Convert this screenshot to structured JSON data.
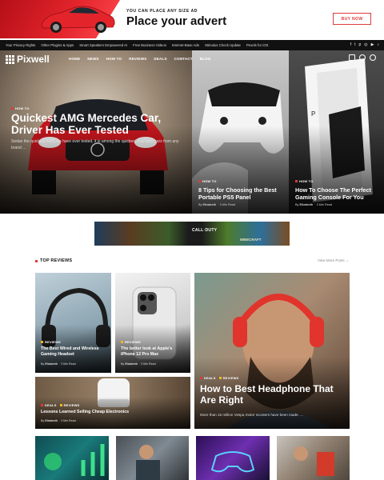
{
  "top_ad": {
    "small_text": "YOU CAN PLACE ANY SIZE AD",
    "headline": "Place your advert",
    "button": "BUY NOW"
  },
  "trending": {
    "links": [
      "Your Privacy Rights",
      "Other Plugins & Apps",
      "Smart Speakers Empowered AI",
      "Free Business Videos",
      "Internet-Base Ads",
      "Stimulus Check Update",
      "Pexels for iOS"
    ],
    "social_icons": [
      "facebook-icon",
      "twitter-icon",
      "pinterest-icon",
      "instagram-icon",
      "youtube-icon",
      "tiktok-icon"
    ]
  },
  "nav": {
    "logo": "Pixwell",
    "menu": [
      "HOME",
      "NEWS",
      "HOW TO",
      "REVIEWS",
      "DEALS",
      "CONTACT",
      "BLOG"
    ]
  },
  "hero": {
    "main": {
      "tag": "HOW TO",
      "title": "Quickest AMG Mercedes Car, Driver Has Ever Tested",
      "excerpt": "Sedan the quickest AMG we have ever tested, it is among the quickest four-door cars from any brand ..."
    },
    "side": [
      {
        "tag": "HOW TO",
        "title": "8 Tips for Choosing the Best Portable PS5 Panel",
        "author": "Elizabeth",
        "read": "3 Min Read"
      },
      {
        "tag": "HOW TO",
        "title": "How To Choose The Perfect Gaming Console For You",
        "author": "Elizabeth",
        "read": "3 Min Read"
      }
    ]
  },
  "banner": {
    "game1": "CALL·DUTY",
    "game2": "MINECRAFT"
  },
  "top_reviews": {
    "heading": "TOP REVIEWS",
    "view_more": "View More Posts →",
    "cards": [
      {
        "tag": "REVIEWS",
        "title": "The Best Wired and Wireless Gaming Headset",
        "author": "Elizabeth",
        "read": "3 Min Read"
      },
      {
        "tag": "REVIEWS",
        "title": "The better look at Apple's iPhone 12 Pro Max",
        "author": "Elizabeth",
        "read": "3 Min Read"
      },
      {
        "tags": [
          "DEALS",
          "REVIEWS"
        ],
        "title": "How to Best Headphone That Are Right",
        "excerpt": "More than 15 million Vespa motor scooters have been made. ..."
      },
      {
        "tags": [
          "DEALS",
          "REVIEWS"
        ],
        "title": "Lessons Learned Selling Cheap Electronics",
        "author": "Elizabeth",
        "read": "3 Min Read"
      }
    ]
  },
  "colors": {
    "accent": "#e13a3a",
    "tag_yellow": "#f3b820",
    "dark": "#111111"
  }
}
